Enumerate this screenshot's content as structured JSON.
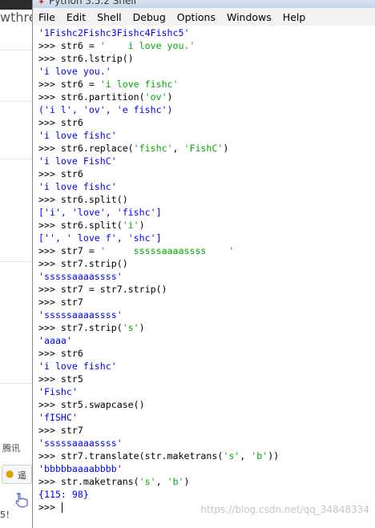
{
  "background_app": {
    "title_fragment": "wthre",
    "label_fragment": "腾讯",
    "button_fragment": "遥",
    "footer_fragment": "5！"
  },
  "window": {
    "title": "Python 3.5.2 Shell"
  },
  "menu": [
    "File",
    "Edit",
    "Shell",
    "Debug",
    "Options",
    "Windows",
    "Help"
  ],
  "console": {
    "lines": [
      {
        "kind": "out",
        "text": "'1Fishc2Fishc3Fishc4Fishc5'"
      },
      {
        "kind": "in",
        "prompt": ">>> ",
        "parts": [
          {
            "t": "cmd",
            "v": "str6 = "
          },
          {
            "t": "str",
            "v": "'    i love you.'"
          }
        ]
      },
      {
        "kind": "in",
        "prompt": ">>> ",
        "parts": [
          {
            "t": "cmd",
            "v": "str6.lstrip()"
          }
        ]
      },
      {
        "kind": "out",
        "text": "'i love you.'"
      },
      {
        "kind": "in",
        "prompt": ">>> ",
        "parts": [
          {
            "t": "cmd",
            "v": "str6 = "
          },
          {
            "t": "str",
            "v": "'i love fishc'"
          }
        ]
      },
      {
        "kind": "in",
        "prompt": ">>> ",
        "parts": [
          {
            "t": "cmd",
            "v": "str6.partition("
          },
          {
            "t": "str",
            "v": "'ov'"
          },
          {
            "t": "cmd",
            "v": ")"
          }
        ]
      },
      {
        "kind": "out",
        "text": "('i l', 'ov', 'e fishc')"
      },
      {
        "kind": "in",
        "prompt": ">>> ",
        "parts": [
          {
            "t": "cmd",
            "v": "str6"
          }
        ]
      },
      {
        "kind": "out",
        "text": "'i love fishc'"
      },
      {
        "kind": "in",
        "prompt": ">>> ",
        "parts": [
          {
            "t": "cmd",
            "v": "str6.replace("
          },
          {
            "t": "str",
            "v": "'fishc'"
          },
          {
            "t": "cmd",
            "v": ", "
          },
          {
            "t": "str",
            "v": "'FishC'"
          },
          {
            "t": "cmd",
            "v": ")"
          }
        ]
      },
      {
        "kind": "out",
        "text": "'i love FishC'"
      },
      {
        "kind": "in",
        "prompt": ">>> ",
        "parts": [
          {
            "t": "cmd",
            "v": "str6"
          }
        ]
      },
      {
        "kind": "out",
        "text": "'i love fishc'"
      },
      {
        "kind": "in",
        "prompt": ">>> ",
        "parts": [
          {
            "t": "cmd",
            "v": "str6.split()"
          }
        ]
      },
      {
        "kind": "out",
        "text": "['i', 'love', 'fishc']"
      },
      {
        "kind": "in",
        "prompt": ">>> ",
        "parts": [
          {
            "t": "cmd",
            "v": "str6.split("
          },
          {
            "t": "str",
            "v": "'i'"
          },
          {
            "t": "cmd",
            "v": ")"
          }
        ]
      },
      {
        "kind": "out",
        "text": "['', ' love f', 'shc']"
      },
      {
        "kind": "in",
        "prompt": ">>> ",
        "parts": [
          {
            "t": "cmd",
            "v": "str7 = "
          },
          {
            "t": "str",
            "v": "'     sssssaaaassss    '"
          }
        ]
      },
      {
        "kind": "in",
        "prompt": ">>> ",
        "parts": [
          {
            "t": "cmd",
            "v": "str7.strip()"
          }
        ]
      },
      {
        "kind": "out",
        "text": "'sssssaaaassss'"
      },
      {
        "kind": "in",
        "prompt": ">>> ",
        "parts": [
          {
            "t": "cmd",
            "v": "str7 = str7.strip()"
          }
        ]
      },
      {
        "kind": "in",
        "prompt": ">>> ",
        "parts": [
          {
            "t": "cmd",
            "v": "str7"
          }
        ]
      },
      {
        "kind": "out",
        "text": "'sssssaaaassss'"
      },
      {
        "kind": "in",
        "prompt": ">>> ",
        "parts": [
          {
            "t": "cmd",
            "v": "str7.strip("
          },
          {
            "t": "str",
            "v": "'s'"
          },
          {
            "t": "cmd",
            "v": ")"
          }
        ]
      },
      {
        "kind": "out",
        "text": "'aaaa'"
      },
      {
        "kind": "in",
        "prompt": ">>> ",
        "parts": [
          {
            "t": "cmd",
            "v": "str6"
          }
        ]
      },
      {
        "kind": "out",
        "text": "'i love fishc'"
      },
      {
        "kind": "in",
        "prompt": ">>> ",
        "parts": [
          {
            "t": "cmd",
            "v": "str5"
          }
        ]
      },
      {
        "kind": "out",
        "text": "'Fishc'"
      },
      {
        "kind": "in",
        "prompt": ">>> ",
        "parts": [
          {
            "t": "cmd",
            "v": "str5.swapcase()"
          }
        ]
      },
      {
        "kind": "out",
        "text": "'fISHC'"
      },
      {
        "kind": "in",
        "prompt": ">>> ",
        "parts": [
          {
            "t": "cmd",
            "v": "str7"
          }
        ]
      },
      {
        "kind": "out",
        "text": "'sssssaaaassss'"
      },
      {
        "kind": "in",
        "prompt": ">>> ",
        "parts": [
          {
            "t": "cmd",
            "v": "str7.translate(str.maketrans("
          },
          {
            "t": "str",
            "v": "'s'"
          },
          {
            "t": "cmd",
            "v": ", "
          },
          {
            "t": "str",
            "v": "'b'"
          },
          {
            "t": "cmd",
            "v": "))"
          }
        ]
      },
      {
        "kind": "out",
        "text": "'bbbbbaaaabbbb'"
      },
      {
        "kind": "in",
        "prompt": ">>> ",
        "parts": [
          {
            "t": "cmd",
            "v": "str.maketrans("
          },
          {
            "t": "str",
            "v": "'s'"
          },
          {
            "t": "cmd",
            "v": ", "
          },
          {
            "t": "str",
            "v": "'b'"
          },
          {
            "t": "cmd",
            "v": ")"
          }
        ]
      },
      {
        "kind": "out",
        "text": "{115: 98}"
      },
      {
        "kind": "prompt",
        "prompt": ">>> "
      }
    ]
  },
  "watermark": "https://blog.csdn.net/qq_34848334",
  "colors": {
    "output": "#0000ff",
    "string": "#00aa00",
    "text": "#000000"
  }
}
